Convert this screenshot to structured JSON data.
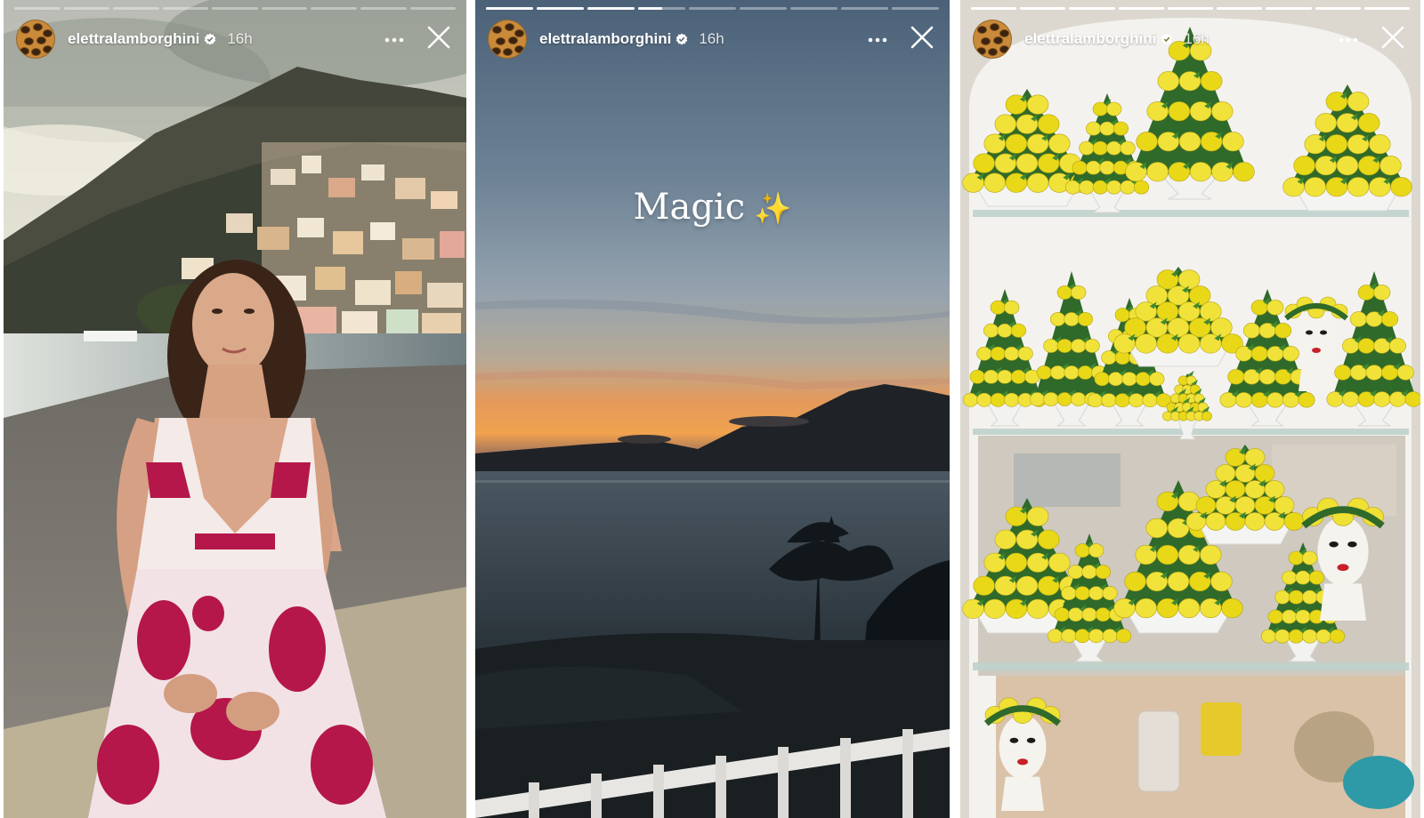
{
  "stories": [
    {
      "username": "elettralamborghini",
      "time": "16h",
      "progress": {
        "total": 9,
        "completed": 0,
        "current_fraction": 0.0
      }
    },
    {
      "username": "elettralamborghini",
      "time": "16h",
      "caption": "Magic",
      "caption_emoji": "✨",
      "progress": {
        "total": 9,
        "completed": 3,
        "current_fraction": 0.5
      }
    },
    {
      "username": "elettralamborghini",
      "time": "16h",
      "progress": {
        "total": 9,
        "completed": 9,
        "current_fraction": 0.0
      }
    }
  ],
  "icons": {
    "more": "more-horizontal-icon",
    "close": "close-icon",
    "verified": "verified-badge-icon"
  },
  "colors": {
    "verified_badge": "#ffffff",
    "progress_done": "#ffffff"
  }
}
